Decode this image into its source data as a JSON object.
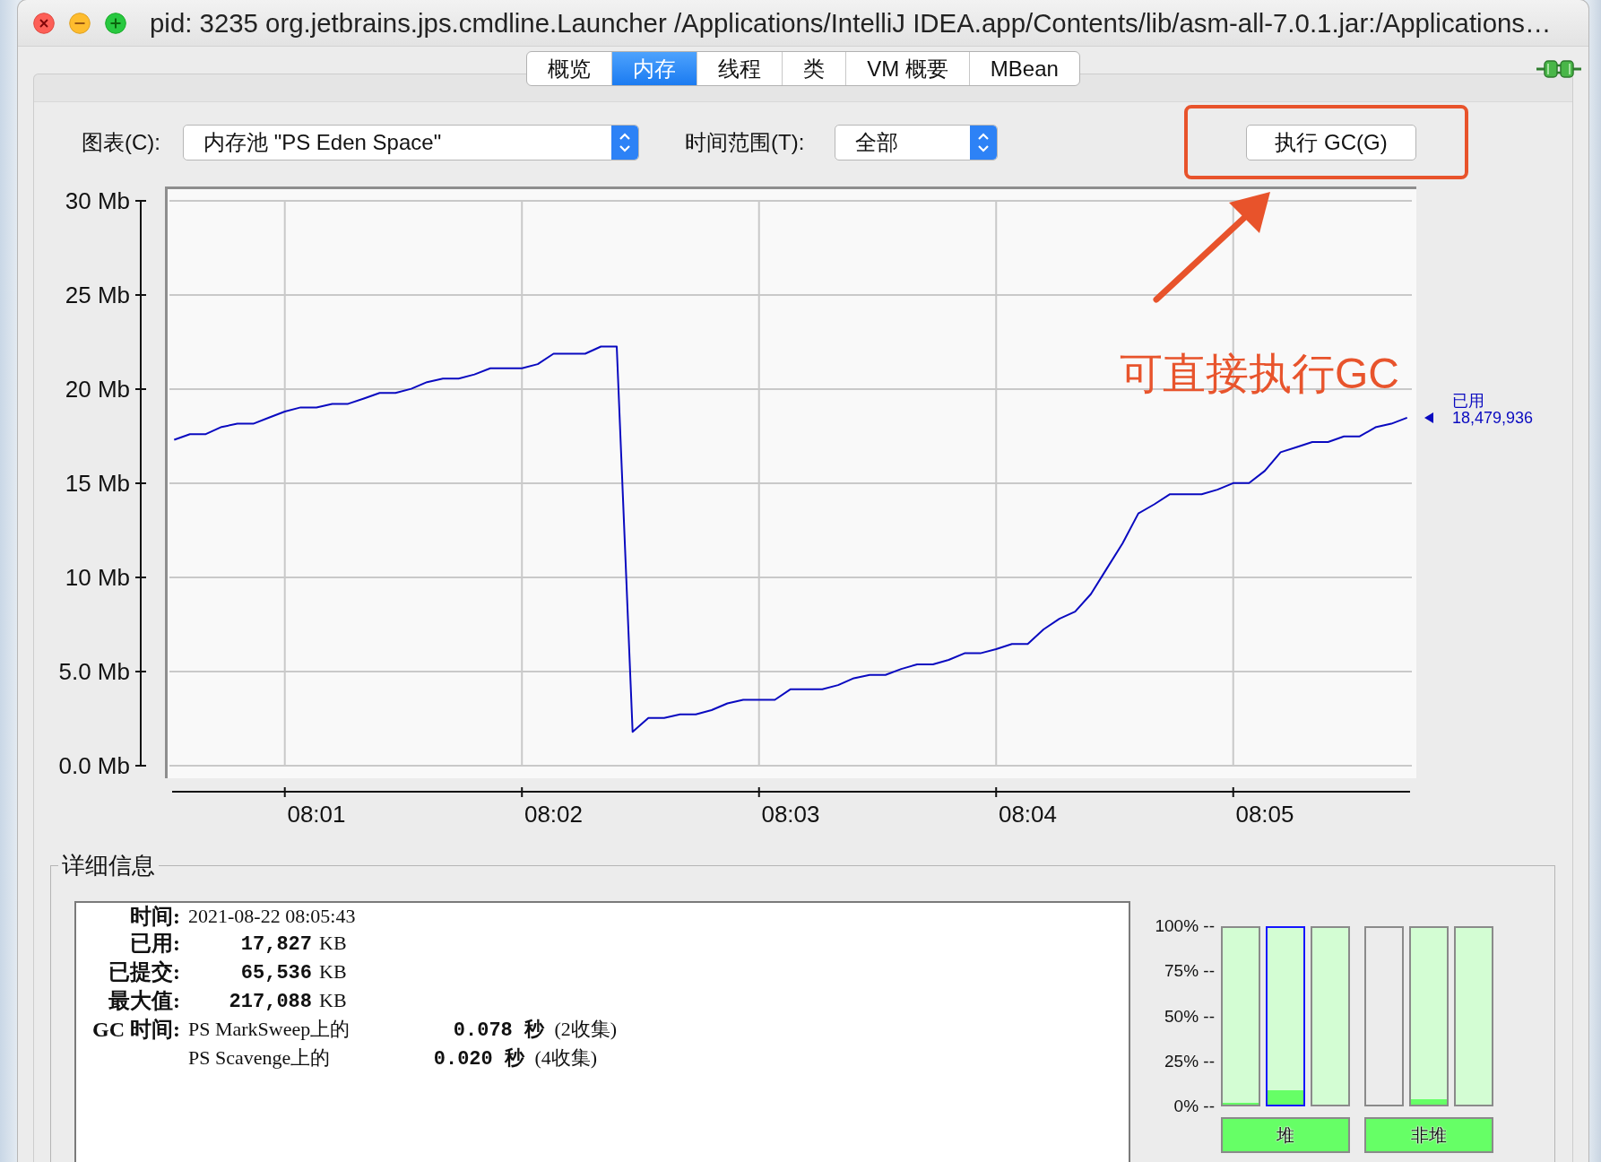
{
  "window": {
    "title": "pid: 3235 org.jetbrains.jps.cmdline.Launcher /Applications/IntelliJ IDEA.app/Contents/lib/asm-all-7.0.1.jar:/Applications…"
  },
  "tabs": [
    {
      "label": "概览",
      "selected": false
    },
    {
      "label": "内存",
      "selected": true
    },
    {
      "label": "线程",
      "selected": false
    },
    {
      "label": "类",
      "selected": false
    },
    {
      "label": "VM 概要",
      "selected": false
    },
    {
      "label": "MBean",
      "selected": false
    }
  ],
  "toolbar": {
    "chart_label": "图表(C):",
    "chart_select": {
      "value": "内存池 \"PS Eden Space\""
    },
    "range_label": "时间范围(T):",
    "range_select": {
      "value": "全部"
    },
    "gc_button": "执行 GC(G)"
  },
  "memory_chart": {
    "legend_value": "18,479,936",
    "chart_data": {
      "type": "line",
      "grid": true,
      "categories": [
        null,
        null,
        null,
        null,
        null,
        null,
        null,
        null,
        null,
        "08:01",
        null,
        null,
        null,
        null,
        null,
        null,
        null,
        null,
        null,
        null,
        null,
        null,
        null,
        null,
        "08:02",
        null,
        null,
        null,
        null,
        null,
        null,
        null,
        null,
        null,
        null,
        null,
        null,
        null,
        null,
        "08:03",
        null,
        null,
        null,
        null,
        null,
        null,
        null,
        null,
        null,
        null,
        null,
        null,
        null,
        null,
        "08:04",
        null,
        null,
        null,
        null,
        null,
        null,
        null,
        null,
        null,
        null,
        null,
        null,
        null,
        null,
        "08:05",
        null,
        null,
        null,
        null,
        null,
        null,
        null,
        null,
        null
      ],
      "series": [
        {
          "name": "已用",
          "color": "#0a0ac0",
          "values": [
            17.31,
            17.61,
            17.61,
            17.99,
            18.16,
            18.16,
            18.49,
            18.81,
            19.03,
            19.03,
            19.22,
            19.22,
            19.5,
            19.8,
            19.8,
            20.02,
            20.37,
            20.56,
            20.56,
            20.78,
            21.11,
            21.11,
            21.11,
            21.33,
            21.88,
            21.88,
            21.88,
            22.26,
            22.26,
            1.8,
            2.54,
            2.54,
            2.73,
            2.73,
            2.95,
            3.31,
            3.5,
            3.5,
            3.5,
            4.06,
            4.06,
            4.06,
            4.28,
            4.65,
            4.82,
            4.82,
            5.14,
            5.38,
            5.38,
            5.62,
            5.97,
            5.97,
            6.19,
            6.46,
            6.46,
            7.24,
            7.8,
            8.18,
            9.12,
            10.47,
            11.81,
            13.4,
            13.88,
            14.42,
            14.42,
            14.42,
            14.66,
            15.01,
            15.01,
            15.66,
            16.65,
            16.92,
            17.19,
            17.19,
            17.49,
            17.49,
            17.97,
            18.16,
            18.48
          ]
        }
      ],
      "ylim": [
        0,
        30
      ],
      "yticks": [
        {
          "value": 0,
          "label": "0.0 Mb"
        },
        {
          "value": 5,
          "label": "5.0 Mb"
        },
        {
          "value": 10,
          "label": "10 Mb"
        },
        {
          "value": 15,
          "label": "15 Mb"
        },
        {
          "value": 20,
          "label": "20 Mb"
        },
        {
          "value": 25,
          "label": "25 Mb"
        },
        {
          "value": 30,
          "label": "30 Mb"
        }
      ]
    }
  },
  "callout": {
    "text": "可直接执行GC"
  },
  "details": {
    "title": "详细信息",
    "rows": [
      {
        "kind": "text",
        "label": "时间:",
        "value": "2021-08-22 08:05:43"
      },
      {
        "kind": "size",
        "label": "已用:",
        "value": "17,827",
        "unit": "KB"
      },
      {
        "kind": "size",
        "label": "已提交:",
        "value": "65,536",
        "unit": "KB"
      },
      {
        "kind": "size",
        "label": "最大值:",
        "value": "217,088",
        "unit": "KB"
      },
      {
        "kind": "gc",
        "label": "GC 时间:",
        "collectors": [
          {
            "name": "PS MarkSweep上的",
            "time": "0.078 秒",
            "count": "(2收集)"
          },
          {
            "name": "PS Scavenge上的",
            "time": "0.020 秒",
            "count": "(4收集)"
          }
        ]
      }
    ]
  },
  "pool_bars": {
    "scale": [
      "100% --",
      "75% --",
      "50% --",
      "25% --",
      "0% --"
    ],
    "groups": [
      {
        "label": "堆",
        "bars": [
          {
            "level": 0.01,
            "shaded": true,
            "selected": false
          },
          {
            "level": 0.08,
            "shaded": true,
            "selected": true
          },
          {
            "shaded": true,
            "selected": false
          }
        ]
      },
      {
        "label": "非堆",
        "bars": [
          {
            "shaded": false,
            "selected": false
          },
          {
            "level": 0.03,
            "shaded": true,
            "selected": false
          },
          {
            "shaded": true,
            "selected": false
          }
        ]
      }
    ]
  }
}
